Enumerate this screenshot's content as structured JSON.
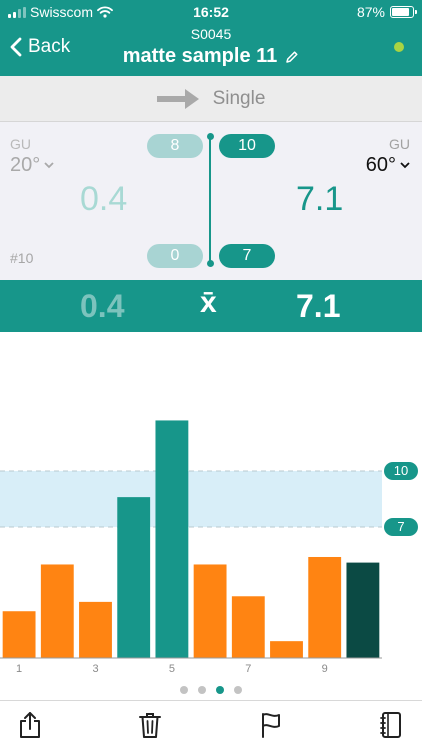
{
  "status_bar": {
    "carrier": "Swisscom",
    "time": "16:52",
    "battery": "87%",
    "battery_level": 0.87
  },
  "header": {
    "back_label": "Back",
    "sample_id": "S0045",
    "title": "matte sample 11",
    "connection_color": "#a9d442"
  },
  "mode": {
    "label": "Single"
  },
  "readings": {
    "left": {
      "unit": "GU",
      "angle": "20°",
      "value": "0.4",
      "range_top": "8",
      "range_bottom": "0"
    },
    "right": {
      "unit": "GU",
      "angle": "60°",
      "value": "7.1",
      "range_top": "10",
      "range_bottom": "7"
    },
    "measurement_number": "#10"
  },
  "mean": {
    "left": "0.4",
    "symbol": "x̄",
    "right": "7.1"
  },
  "chart_data": {
    "type": "bar",
    "x": [
      1,
      2,
      3,
      4,
      5,
      6,
      7,
      8,
      9,
      10
    ],
    "x_tick_labels": [
      "1",
      "3",
      "5",
      "7",
      "9"
    ],
    "values": [
      2.5,
      5.0,
      3.0,
      8.6,
      12.7,
      5.0,
      3.3,
      0.9,
      5.4,
      5.1
    ],
    "ylim": [
      0,
      17
    ],
    "upper_limit": 10,
    "lower_limit": 7,
    "limit_labels": [
      "10",
      "7"
    ],
    "colors": {
      "in_range": "#17968a",
      "out_of_range": "#ff8412",
      "latest": "#0b4a44",
      "band": "#d8eef8"
    }
  },
  "pager": {
    "count": 4,
    "active": 2
  },
  "toolbar": {
    "icons": [
      "share-icon",
      "trash-icon",
      "flag-icon",
      "notebook-icon"
    ]
  },
  "theme": {
    "primary": "#17968a",
    "light": "#a8d4d3"
  }
}
